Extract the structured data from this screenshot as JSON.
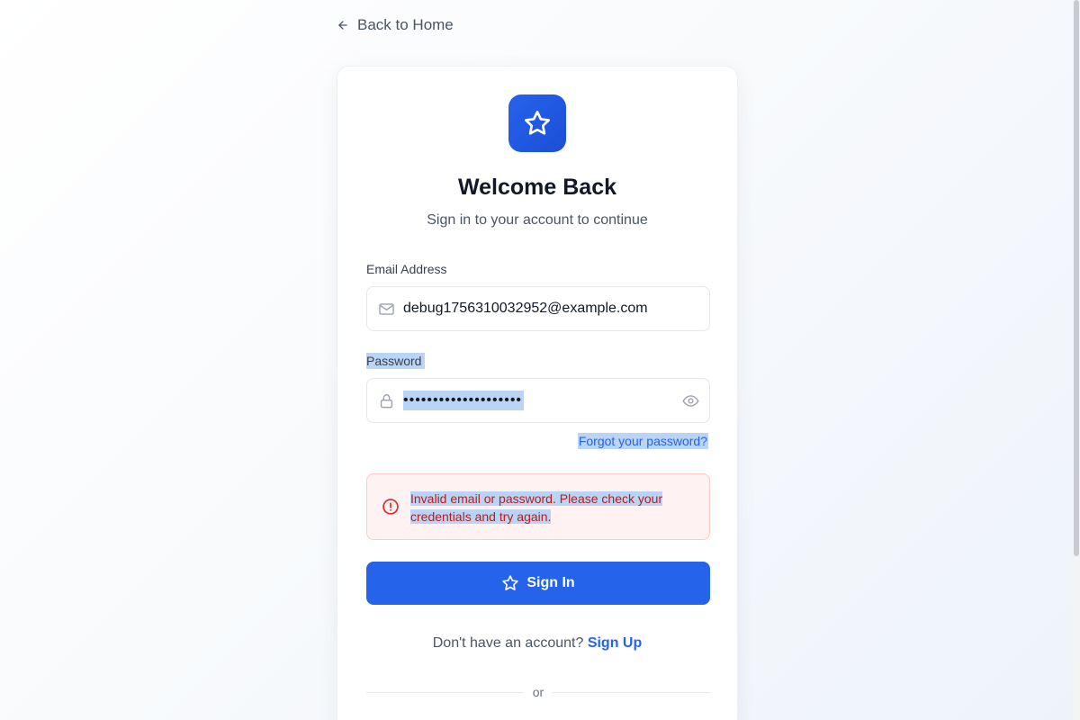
{
  "nav": {
    "back_label": "Back to Home"
  },
  "header": {
    "logo_icon": "star-icon",
    "title": "Welcome Back",
    "subtitle": "Sign in to your account to continue"
  },
  "form": {
    "email": {
      "label": "Email Address",
      "value": "debug1756310032952@example.com",
      "icon": "mail-icon"
    },
    "password": {
      "label": "Password",
      "masked_value": "••••••••••••••••••••",
      "icon": "lock-icon",
      "toggle_icon": "eye-icon"
    },
    "forgot_label": "Forgot your password?",
    "error": {
      "icon": "alert-circle-icon",
      "message": "Invalid email or password. Please check your credentials and try again."
    },
    "submit_label": "Sign In"
  },
  "footer": {
    "signup_prompt": "Don't have an account?",
    "signup_link": "Sign Up",
    "divider_text": "or"
  },
  "colors": {
    "primary": "#2563eb",
    "error_text": "#b91c1c",
    "error_bg": "#fef2f2",
    "selection": "#b9d4f5"
  }
}
